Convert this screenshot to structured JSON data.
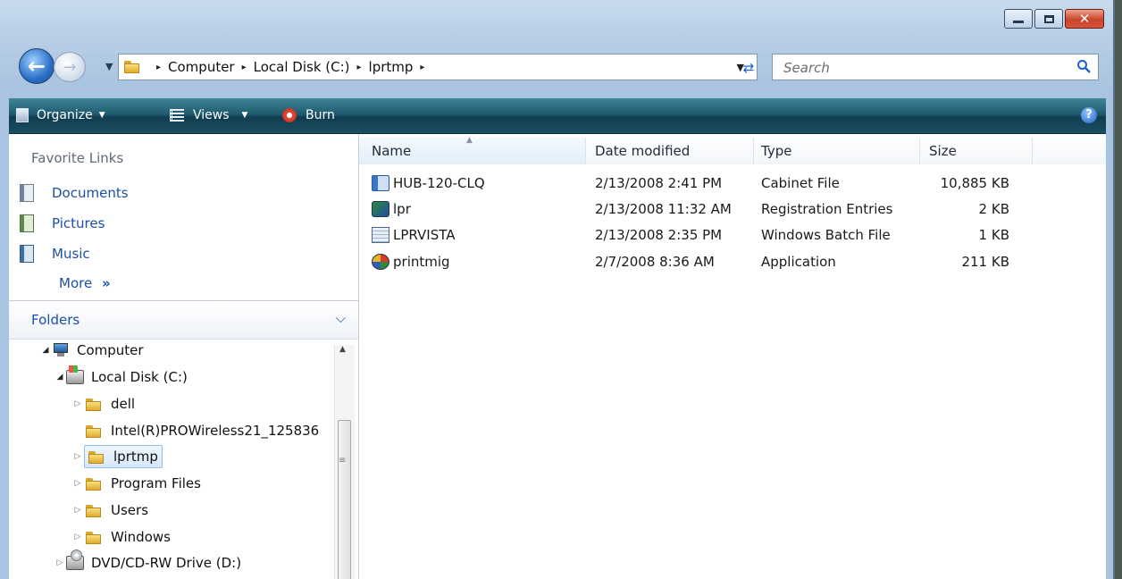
{
  "window": {
    "caption": {
      "minimize": "–",
      "maximize": "□",
      "close": "✕"
    }
  },
  "address": {
    "crumbs": [
      "Computer",
      "Local Disk (C:)",
      "lprtmp"
    ],
    "separator": "▸"
  },
  "search": {
    "placeholder": "Search"
  },
  "toolbar": {
    "organize": "Organize",
    "views": "Views",
    "burn": "Burn",
    "help": "?"
  },
  "favorites": {
    "title": "Favorite Links",
    "links": [
      {
        "label": "Documents",
        "icon": "documents-icon"
      },
      {
        "label": "Pictures",
        "icon": "pictures-icon"
      },
      {
        "label": "Music",
        "icon": "music-icon"
      }
    ],
    "more": "More",
    "more_glyph": "»"
  },
  "folders": {
    "title": "Folders",
    "chevron": "⌄",
    "tree": [
      {
        "label": "Computer",
        "level": 0,
        "expanded": true,
        "icon": "computer-icon"
      },
      {
        "label": "Local Disk (C:)",
        "level": 1,
        "expanded": true,
        "icon": "disk-icon"
      },
      {
        "label": "dell",
        "level": 2,
        "expanded": false,
        "icon": "folder-icon"
      },
      {
        "label": "Intel(R)PROWireless21_125836",
        "level": 2,
        "expanded": null,
        "icon": "folder-icon"
      },
      {
        "label": "lprtmp",
        "level": 2,
        "expanded": false,
        "selected": true,
        "icon": "folder-icon"
      },
      {
        "label": "Program Files",
        "level": 2,
        "expanded": false,
        "icon": "folder-icon"
      },
      {
        "label": "Users",
        "level": 2,
        "expanded": false,
        "icon": "folder-icon"
      },
      {
        "label": "Windows",
        "level": 2,
        "expanded": false,
        "icon": "folder-icon"
      },
      {
        "label": "DVD/CD-RW Drive (D:)",
        "level": 1,
        "expanded": false,
        "icon": "dvd-drive-icon"
      }
    ]
  },
  "files": {
    "columns": [
      "Name",
      "Date modified",
      "Type",
      "Size"
    ],
    "sorted_by": "Name",
    "rows": [
      {
        "name": "HUB-120-CLQ",
        "date": "2/13/2008 2:41 PM",
        "type": "Cabinet File",
        "size": "10,885 KB",
        "icon": "cabinet-file-icon"
      },
      {
        "name": "lpr",
        "date": "2/13/2008 11:32 AM",
        "type": "Registration Entries",
        "size": "2 KB",
        "icon": "registry-file-icon"
      },
      {
        "name": "LPRVISTA",
        "date": "2/13/2008 2:35 PM",
        "type": "Windows Batch File",
        "size": "1 KB",
        "icon": "batch-file-icon"
      },
      {
        "name": "printmig",
        "date": "2/7/2008 8:36 AM",
        "type": "Application",
        "size": "211 KB",
        "icon": "application-icon"
      }
    ]
  },
  "colors": {
    "toolbar": "#1f5a6e",
    "link": "#1c4fa8",
    "selection": "#d5e9fa"
  }
}
